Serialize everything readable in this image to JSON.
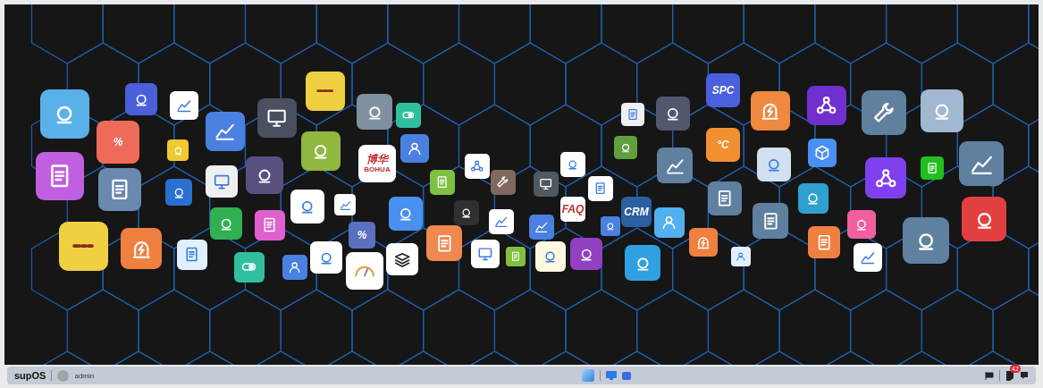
{
  "desktop": {
    "icons": [
      {
        "kind": "glyph",
        "color": "#5ab0e8"
      },
      {
        "kind": "glyph",
        "color": "#4a5fd8"
      },
      {
        "kind": "chart",
        "color": "#ffffff"
      },
      {
        "kind": "text",
        "color": "#f06a5a",
        "texts": [
          "%"
        ]
      },
      {
        "kind": "doc",
        "color": "#c060e0"
      },
      {
        "kind": "doc",
        "color": "#6a88b0"
      },
      {
        "kind": "glyph",
        "color": "#f0c830"
      },
      {
        "kind": "glyph",
        "color": "#2a70d0"
      },
      {
        "kind": "chart",
        "color": "#4a80e0"
      },
      {
        "kind": "monitor",
        "color": "#4a5060"
      },
      {
        "kind": "bar",
        "color": "#f0d040"
      },
      {
        "kind": "monitor",
        "color": "#f0f0f0"
      },
      {
        "kind": "glyph",
        "color": "#5a5080"
      },
      {
        "kind": "glyph",
        "color": "#90b840"
      },
      {
        "kind": "glyph",
        "color": "#30b050"
      },
      {
        "kind": "doc",
        "color": "#e060d0"
      },
      {
        "kind": "glyph",
        "color": "#ffffff"
      },
      {
        "kind": "chart",
        "color": "#ffffff"
      },
      {
        "kind": "bar",
        "color": "#f0d040"
      },
      {
        "kind": "bolt",
        "color": "#f08040"
      },
      {
        "kind": "doc",
        "color": "#e0f0ff"
      },
      {
        "kind": "toggle",
        "color": "#30c0a0"
      },
      {
        "kind": "person",
        "color": "#4a80e0"
      },
      {
        "kind": "glyph",
        "color": "#ffffff"
      },
      {
        "kind": "gauge",
        "color": "#ffffff"
      },
      {
        "kind": "layers",
        "color": "#ffffff"
      },
      {
        "kind": "text",
        "color": "#5a70c0",
        "texts": [
          "%"
        ]
      },
      {
        "kind": "glyph",
        "color": "#8090a0"
      },
      {
        "kind": "toggle",
        "color": "#30c0a0"
      },
      {
        "kind": "text",
        "color": "#ffffff",
        "texts": [
          "博华",
          "BOHUA"
        ]
      },
      {
        "kind": "person",
        "color": "#4a80e0"
      },
      {
        "kind": "doc",
        "color": "#80c040"
      },
      {
        "kind": "hub",
        "color": "#ffffff"
      },
      {
        "kind": "gear",
        "color": "#806860"
      },
      {
        "kind": "glyph",
        "color": "#4a90f0"
      },
      {
        "kind": "glyph",
        "color": "#303030"
      },
      {
        "kind": "doc",
        "color": "#f08850"
      },
      {
        "kind": "chart",
        "color": "#ffffff"
      },
      {
        "kind": "monitor",
        "color": "#ffffff"
      },
      {
        "kind": "doc",
        "color": "#80c040"
      },
      {
        "kind": "chart",
        "color": "#4a80e0"
      },
      {
        "kind": "monitor",
        "color": "#505860"
      },
      {
        "kind": "glyph",
        "color": "#ffffff"
      },
      {
        "kind": "doc",
        "color": "#ffffff"
      },
      {
        "kind": "text",
        "color": "#ffffff",
        "texts": [
          "FAQ"
        ]
      },
      {
        "kind": "glyph",
        "color": "#fff8e0"
      },
      {
        "kind": "glyph",
        "color": "#9040c0"
      },
      {
        "kind": "glyph",
        "color": "#4a80e0"
      },
      {
        "kind": "text",
        "color": "#2a60a0",
        "texts": [
          "CRM"
        ]
      },
      {
        "kind": "person",
        "color": "#50b0f0"
      },
      {
        "kind": "glyph",
        "color": "#30a0e0"
      },
      {
        "kind": "doc",
        "color": "#f0f0f0"
      },
      {
        "kind": "glyph",
        "color": "#60a040"
      },
      {
        "kind": "glyph",
        "color": "#505870"
      },
      {
        "kind": "chart",
        "color": "#6080a0"
      },
      {
        "kind": "bolt",
        "color": "#f08040"
      },
      {
        "kind": "person",
        "color": "#e0f0ff"
      },
      {
        "kind": "text",
        "color": "#4a60e0",
        "texts": [
          "SPC"
        ]
      },
      {
        "kind": "text",
        "color": "#f09030",
        "texts": [
          "°C"
        ]
      },
      {
        "kind": "bolt",
        "color": "#f08840"
      },
      {
        "kind": "glyph",
        "color": "#d0e0f0"
      },
      {
        "kind": "doc",
        "color": "#6080a0"
      },
      {
        "kind": "doc",
        "color": "#6080a0"
      },
      {
        "kind": "cube",
        "color": "#4a90f0"
      },
      {
        "kind": "glyph",
        "color": "#30a0d0"
      },
      {
        "kind": "hub",
        "color": "#7030d0"
      },
      {
        "kind": "doc",
        "color": "#f08040"
      },
      {
        "kind": "glyph",
        "color": "#f060a0"
      },
      {
        "kind": "chart",
        "color": "#ffffff"
      },
      {
        "kind": "gear",
        "color": "#6080a0"
      },
      {
        "kind": "hub",
        "color": "#8040f0"
      },
      {
        "kind": "glyph",
        "color": "#a0b8d0"
      },
      {
        "kind": "doc",
        "color": "#20c020"
      },
      {
        "kind": "chart",
        "color": "#6080a0"
      },
      {
        "kind": "glyph",
        "color": "#e04040"
      },
      {
        "kind": "glyph",
        "color": "#6080a0"
      }
    ]
  },
  "taskbar": {
    "logo": "supOS",
    "user": "admin",
    "notification_count": "42"
  }
}
